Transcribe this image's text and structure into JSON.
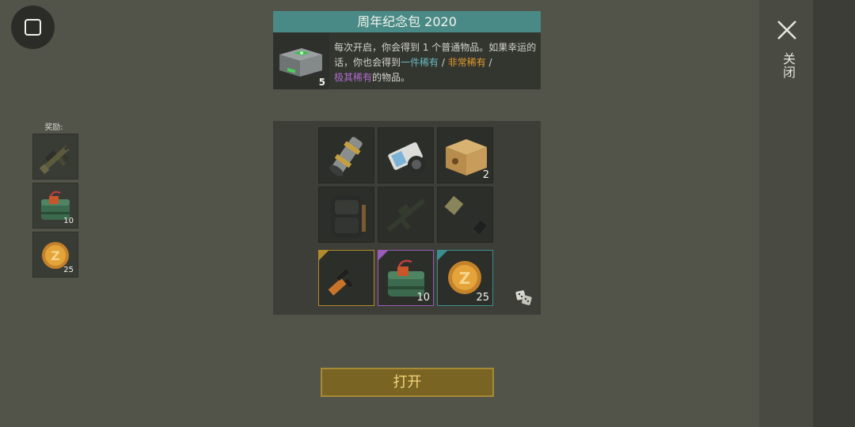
{
  "menu_button": {
    "icon": "square-icon"
  },
  "close": {
    "label": "关闭",
    "icon": "close-x-icon"
  },
  "rewards": {
    "label": "奖励:",
    "items": [
      {
        "icon": "assault-rifle-icon",
        "count": ""
      },
      {
        "icon": "explosive-bag-icon",
        "count": "10"
      },
      {
        "icon": "gold-coin-icon",
        "count": "25"
      }
    ]
  },
  "pack": {
    "title": "周年纪念包 2020",
    "icon": "green-crate-icon",
    "count": "5",
    "desc_prefix": "每次开启，你会得到 1 个普通物品。如果幸运的话，你也会得到",
    "rare_label": "一件稀有",
    "separator1": " / ",
    "very_rare_label": "非常稀有",
    "separator2": " /",
    "epic_label": "极其稀有",
    "desc_suffix": "的物品。"
  },
  "loot": {
    "slots": [
      {
        "icon": "scope-part-icon",
        "count": ""
      },
      {
        "icon": "camera-lens-icon",
        "count": ""
      },
      {
        "icon": "cardboard-box-icon",
        "count": "2"
      },
      {
        "icon": "backpack-icon",
        "count": ""
      },
      {
        "icon": "rifle-silhouette-icon",
        "count": ""
      },
      {
        "icon": "flamethrower-icon",
        "count": ""
      },
      {
        "icon": "sniper-rifle-icon",
        "count": "",
        "rarity": "gold"
      },
      {
        "icon": "explosive-bag-icon",
        "count": "10",
        "rarity": "purple"
      },
      {
        "icon": "gold-coin-icon",
        "count": "25",
        "rarity": "teal"
      }
    ],
    "dice_icon": "dice-icon"
  },
  "open_button": {
    "label": "打开"
  },
  "colors": {
    "background": "#52544a",
    "title_teal": "#4a8a86",
    "rare": "#68b9c0",
    "very_rare": "#e09a2c",
    "epic": "#b06cd0",
    "button": "#7a6424",
    "button_text": "#f5d57a"
  }
}
